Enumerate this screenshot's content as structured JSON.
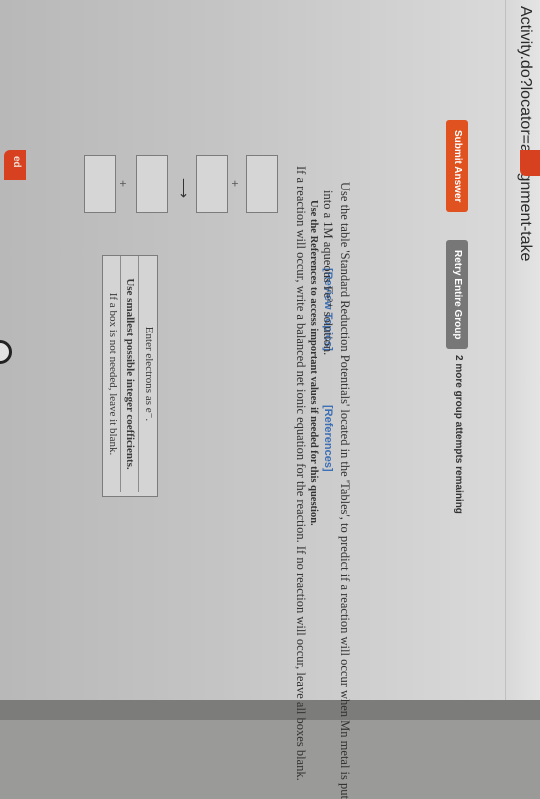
{
  "browser": {
    "url_fragment": "Activity.do?locator=assignment-take"
  },
  "side_tab": {
    "label": "ed"
  },
  "toolbar": {
    "review_topics": "[Review Topics]",
    "references": "[References]"
  },
  "instructions": "Use the References to access important values if needed for this question.",
  "hints": {
    "line1": "Enter electrons as e⁻.",
    "line2": "Use smallest possible integer coefficients.",
    "line3": "If a box is not needed, leave it blank."
  },
  "question": {
    "part1": "Use the table 'Standard Reduction Potentials' located in the 'Tables', to predict if a reaction will occur when Mn metal is put",
    "part1b": "into a 1M aqueous Fe²⁺ solution.",
    "part2": "If a reaction will occur, write a balanced net ionic equation for the reaction. If no reaction will occur, leave all boxes blank."
  },
  "equation": {
    "plus": "+",
    "arrow": "⟶"
  },
  "actions": {
    "submit_label": "Submit Answer",
    "retry_label": "Retry Entire Group",
    "attempts_text": "2 more group attempts remaining"
  }
}
